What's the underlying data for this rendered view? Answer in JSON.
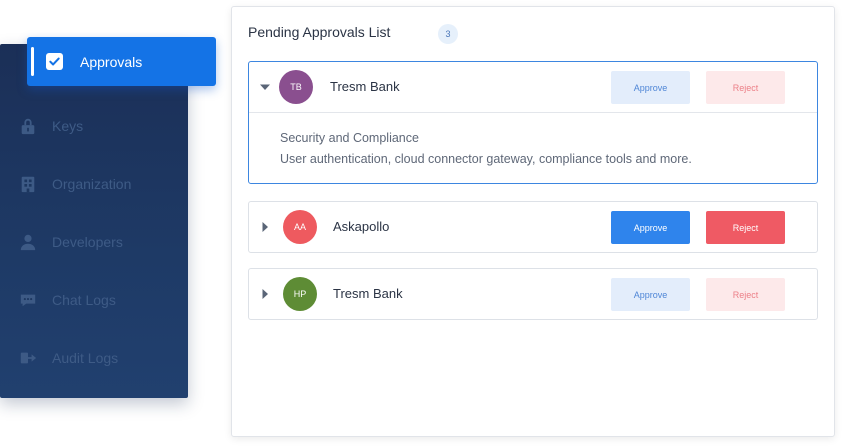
{
  "sidebar": {
    "active": {
      "label": "Approvals",
      "icon": "checkbox-icon"
    },
    "items": [
      {
        "label": "Keys",
        "icon": "lock-icon"
      },
      {
        "label": "Organization",
        "icon": "building-icon"
      },
      {
        "label": "Developers",
        "icon": "person-icon"
      },
      {
        "label": "Chat Logs",
        "icon": "chat-icon"
      },
      {
        "label": "Audit Logs",
        "icon": "logout-icon"
      }
    ]
  },
  "panel": {
    "title": "Pending Approvals List",
    "count": "3"
  },
  "approvals": [
    {
      "initials": "TB",
      "name": "Tresm Bank",
      "avatar_color": "#8a4f8f",
      "expanded": true,
      "approve_label": "Approve",
      "reject_label": "Reject",
      "details": {
        "title": "Security and Compliance",
        "description": "User authentication, cloud connector gateway, compliance tools and more."
      }
    },
    {
      "initials": "AA",
      "name": "Askapollo",
      "avatar_color": "#ee5a5f",
      "expanded": false,
      "approve_label": "Approve",
      "reject_label": "Reject"
    },
    {
      "initials": "HP",
      "name": "Tresm Bank",
      "avatar_color": "#5e8c35",
      "expanded": false,
      "approve_label": "Approve",
      "reject_label": "Reject"
    }
  ],
  "colors": {
    "accent": "#1473e6",
    "sidebar_bg": "#1e3a66",
    "approve": "#2f84ec",
    "reject": "#ef5a64"
  }
}
